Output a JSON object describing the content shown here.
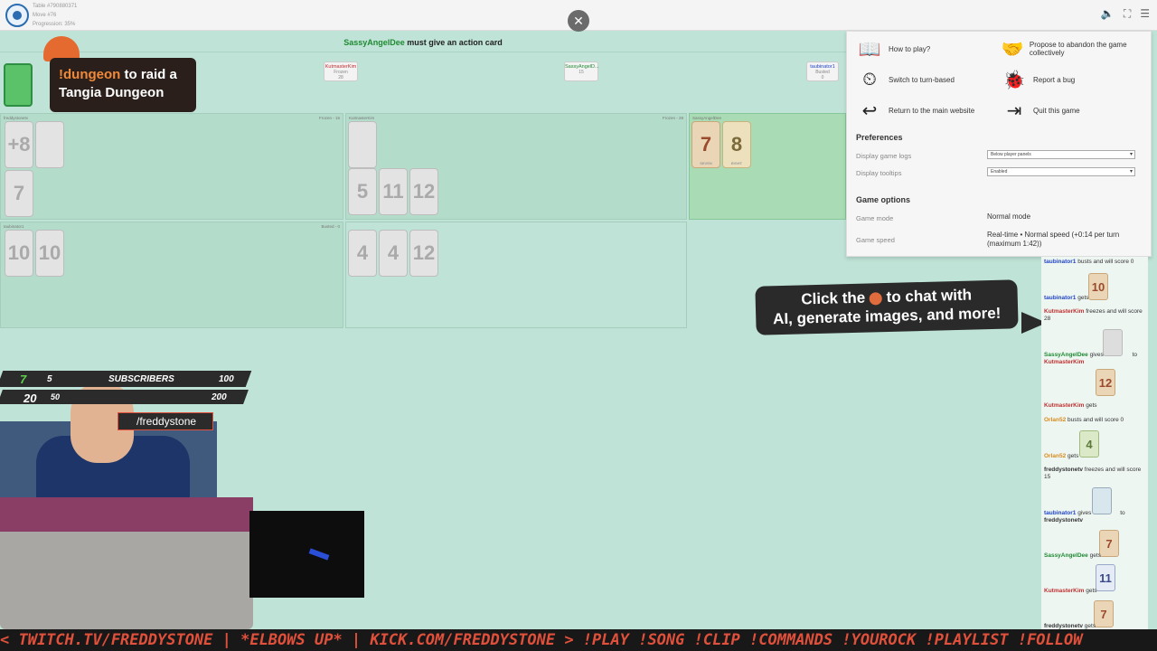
{
  "topbar": {
    "table_info": "Table #790880371",
    "move_info": "Move #76",
    "progress": "Progression: 35%"
  },
  "banner": {
    "player": "SassyAngelDee",
    "message": "must give an action card"
  },
  "tabs": [
    {
      "name": "KutmasterKim",
      "status": "Frozen",
      "score": "28"
    },
    {
      "name": "SassyAngelD...",
      "status": "",
      "score": "15"
    },
    {
      "name": "taubinator1",
      "status": "Busted",
      "score": "0"
    }
  ],
  "zones": {
    "z1": {
      "label": "freddystonetv",
      "right": "Frozen - 15",
      "cards": [
        "+8",
        "",
        "7"
      ]
    },
    "z2": {
      "label": "KutmasterKim",
      "right": "Frozen - 28",
      "cards": [
        "",
        "5",
        "11",
        "12"
      ]
    },
    "z3": {
      "label": "SassyAngelDee",
      "cards": [
        "7",
        "8"
      ],
      "card_subs": [
        "SEVEN",
        "EIGHT"
      ]
    },
    "z4": {
      "label": "taubinator1",
      "right": "Busted - 0",
      "cards": [
        "10",
        "10"
      ]
    },
    "z5": {
      "cards": [
        "4",
        "4",
        "12"
      ]
    }
  },
  "menu": {
    "items": [
      {
        "label": "How to play?",
        "icon": "book-icon"
      },
      {
        "label": "Propose to abandon the game collectively",
        "icon": "handshake-icon"
      },
      {
        "label": "Switch to turn-based",
        "icon": "clock-icon"
      },
      {
        "label": "Report a bug",
        "icon": "bug-icon"
      },
      {
        "label": "Return to the main website",
        "icon": "return-arrow-icon"
      },
      {
        "label": "Quit this game",
        "icon": "exit-icon"
      }
    ],
    "preferences_title": "Preferences",
    "display_logs_label": "Display game logs",
    "display_logs_value": "Below player panels",
    "display_tooltips_label": "Display tooltips",
    "display_tooltips_value": "Enabled",
    "game_options_title": "Game options",
    "game_mode_label": "Game mode",
    "game_mode_value": "Normal mode",
    "game_speed_label": "Game speed",
    "game_speed_value": "Real-time • Normal speed (+0:14 per turn (maximum 1:42))"
  },
  "log": [
    {
      "user": "taubinator1",
      "text": "busts and will score 0"
    },
    {
      "user": "taubinator1",
      "text": "gets"
    },
    {
      "user": "KutmasterKim",
      "text": "freezes and will score 28"
    },
    {
      "user": "SassyAngelDee",
      "text": "gives"
    },
    {
      "user": "KutmasterKim",
      "text": "gets"
    },
    {
      "user": "Orlan52",
      "text": "busts and will score 0"
    },
    {
      "user": "Orlan52",
      "text": "gets"
    },
    {
      "user": "freddystonetv",
      "text": "freezes and will score 15"
    },
    {
      "user": "taubinator1",
      "text": "gives"
    },
    {
      "user": "freddystonetv",
      "text": ""
    },
    {
      "user": "SassyAngelDee",
      "text": "gets"
    },
    {
      "user": "KutmasterKim",
      "text": "gets"
    },
    {
      "user": "freddystonetv",
      "text": "gets"
    }
  ],
  "log_targets": {
    "kutmaster": "KutmasterKim",
    "freddy": "freddystonetv",
    "to": "to"
  },
  "log_cards": [
    "10",
    "",
    "12",
    "4",
    "11",
    "7"
  ],
  "ai_bubble": {
    "pre": "Click the",
    "post": "to chat with",
    "line2": "AI, generate images, and more!"
  },
  "dungeon": {
    "cmd": "!dungeon",
    "rest": "to raid a",
    "line2": "Tangia Dungeon"
  },
  "stream": {
    "sub_count": "7",
    "sub_small": "5",
    "subscribers": "SUBSCRIBERS",
    "goal1": "100",
    "twitch_count": "20",
    "twitch_small": "50",
    "goal2": "200",
    "handle": "/freddystone"
  },
  "ticker": "<  TWITCH.TV/FREDDYSTONE  |  *ELBOWS UP*  |  KICK.COM/FREDDYSTONE  >   !PLAY !SONG !CLIP !COMMANDS !YOUROCK !PLAYLIST !FOLLOW",
  "colors": {
    "table_bg": "#bfe3d6",
    "active_player": "#1f8a32",
    "log_blue": "#2245c9",
    "log_red": "#c03030",
    "log_orange": "#d98a1a"
  }
}
